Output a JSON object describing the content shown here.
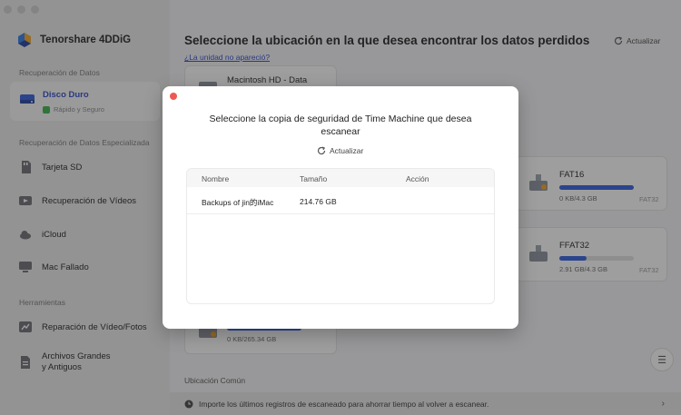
{
  "app": {
    "name": "Tenorshare 4DDiG"
  },
  "sidebar": {
    "section_recovery": "Recuperación de Datos",
    "active_item": {
      "label": "Disco Duro",
      "sub": "Rápido y Seguro"
    },
    "section_special": "Recuperación de Datos Especializada",
    "special_items": [
      {
        "label": "Tarjeta SD",
        "icon": "sd-card-icon"
      },
      {
        "label": "Recuperación de Vídeos",
        "icon": "video-icon"
      },
      {
        "label": "iCloud",
        "icon": "cloud-icon"
      },
      {
        "label": "Mac Fallado",
        "icon": "mac-icon"
      }
    ],
    "section_tools": "Herramientas",
    "tool_items": [
      {
        "label": "Reparación de Vídeo/Fotos",
        "icon": "repair-icon"
      },
      {
        "label": "Archivos Grandes",
        "label2": "y Antiguos",
        "icon": "files-icon"
      }
    ]
  },
  "main": {
    "title": "Seleccione la ubicación en la que desea encontrar los datos perdidos",
    "link": "¿La unidad no apareció?",
    "refresh": "Actualizar",
    "drives": [
      {
        "name": "Macintosh HD - Data"
      },
      {
        "name": "FAT16",
        "size": "0 KB/4.3 GB",
        "fs": "FAT32",
        "used": 1.0
      },
      {
        "name": "FFAT32",
        "size": "2.91 GB/4.3 GB",
        "fs": "FAT32",
        "used": 0.36
      },
      {
        "size": "0 KB/265.34 GB",
        "used": 1.0
      }
    ],
    "common_location": "Ubicación Común",
    "bottom_message": "Importe los últimos registros de escaneado para ahorrar tiempo al volver a escanear.",
    "colors": {
      "accent": "#2f5bdc",
      "link": "#2b48c9",
      "warning": "#f0a020"
    }
  },
  "modal": {
    "title": "Seleccione la copia de seguridad de Time Machine que desea escanear",
    "refresh": "Actualizar",
    "columns": [
      "Nombre",
      "Tamaño",
      "Acción"
    ],
    "rows": [
      {
        "name": "Backups of jin的iMac",
        "size": "214.76 GB",
        "action": ""
      }
    ]
  }
}
